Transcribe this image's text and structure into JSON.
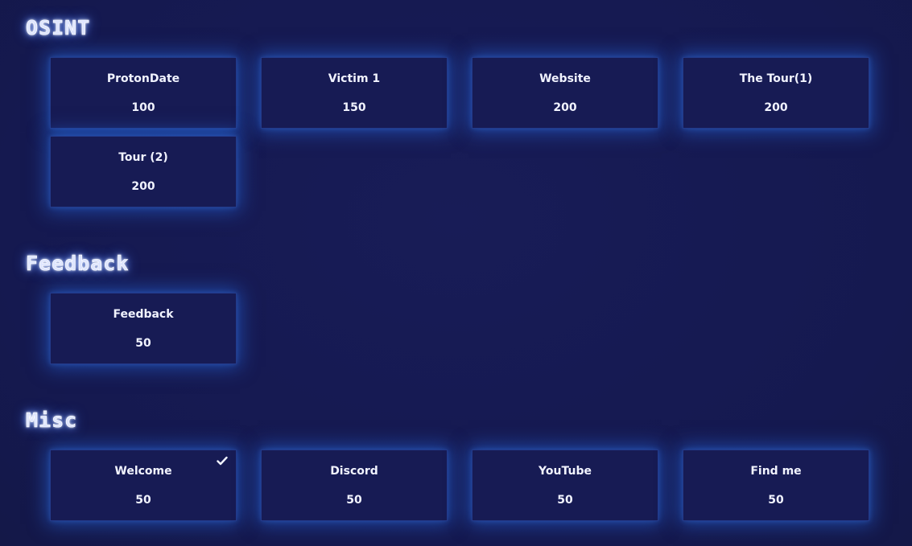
{
  "categories": [
    {
      "title": "OSINT",
      "challenges": [
        {
          "name": "ProtonDate",
          "points": "100",
          "solved": false
        },
        {
          "name": "Victim 1",
          "points": "150",
          "solved": false
        },
        {
          "name": "Website",
          "points": "200",
          "solved": false
        },
        {
          "name": "The Tour(1)",
          "points": "200",
          "solved": false
        },
        {
          "name": "Tour (2)",
          "points": "200",
          "solved": false
        }
      ]
    },
    {
      "title": "Feedback",
      "challenges": [
        {
          "name": "Feedback",
          "points": "50",
          "solved": false
        }
      ]
    },
    {
      "title": "Misc",
      "challenges": [
        {
          "name": "Welcome",
          "points": "50",
          "solved": true
        },
        {
          "name": "Discord",
          "points": "50",
          "solved": false
        },
        {
          "name": "YouTube",
          "points": "50",
          "solved": false
        },
        {
          "name": "Find me",
          "points": "50",
          "solved": false
        }
      ]
    }
  ],
  "icons": {
    "solved": "checkmark-icon"
  },
  "colors": {
    "background": "#161a52",
    "card": "#171b54",
    "glow": "#286ee6",
    "text": "#f1f3ff"
  }
}
